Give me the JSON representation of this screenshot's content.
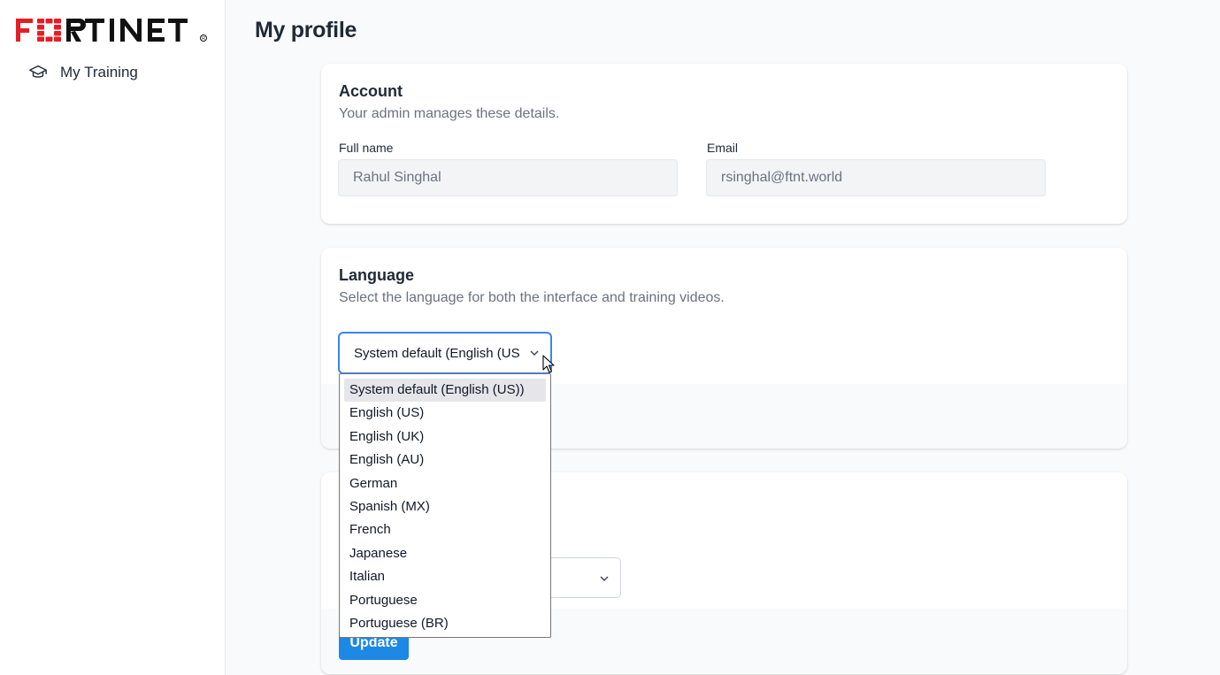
{
  "brand": {
    "logo_text": "FORTINET",
    "logo_color": "#e41e26"
  },
  "sidebar": {
    "items": [
      {
        "label": "My Training",
        "icon": "graduation-cap-icon"
      }
    ]
  },
  "page": {
    "title": "My profile"
  },
  "account": {
    "title": "Account",
    "subtitle": "Your admin manages these details.",
    "full_name_label": "Full name",
    "full_name_value": "Rahul Singhal",
    "email_label": "Email",
    "email_value": "rsinghal@ftnt.world"
  },
  "language": {
    "title": "Language",
    "subtitle": "Select the language for both the interface and training videos.",
    "selected_display": "System default (English (US)",
    "options": [
      "System default (English (US))",
      "English (US)",
      "English (UK)",
      "English (AU)",
      "German",
      "Spanish (MX)",
      "French",
      "Japanese",
      "Italian",
      "Portuguese",
      "Portuguese (BR)"
    ],
    "highlighted_index": 0
  },
  "third_card": {
    "update_label": "Update"
  },
  "colors": {
    "accent": "#1e88e5",
    "focus": "#3b82f6"
  }
}
